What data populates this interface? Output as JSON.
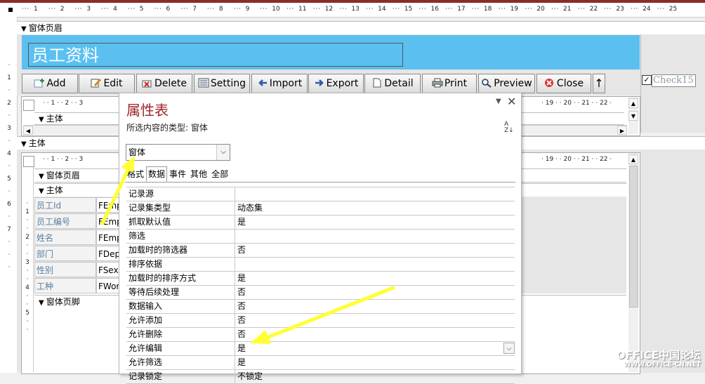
{
  "header": {
    "section_label": "窗体页眉",
    "form_title": "员工资料",
    "checkbox_label": "Check15"
  },
  "ruler_numbers": [
    "1",
    "2",
    "3",
    "4",
    "5",
    "6",
    "7",
    "8",
    "9",
    "10",
    "11",
    "12",
    "13",
    "14",
    "15",
    "16",
    "17",
    "18",
    "19",
    "20",
    "21",
    "22",
    "23",
    "24",
    "25"
  ],
  "toolbar": [
    {
      "label": "Add",
      "icon": "add-icon"
    },
    {
      "label": "Edit",
      "icon": "edit-icon"
    },
    {
      "label": "Delete",
      "icon": "delete-icon"
    },
    {
      "label": "Setting",
      "icon": "setting-icon"
    },
    {
      "label": "Import",
      "icon": "import-icon"
    },
    {
      "label": "Export",
      "icon": "export-icon"
    },
    {
      "label": "Detail",
      "icon": "detail-icon"
    },
    {
      "label": "Print",
      "icon": "print-icon"
    },
    {
      "label": "Preview",
      "icon": "preview-icon"
    },
    {
      "label": "Close",
      "icon": "close-icon"
    }
  ],
  "up_arrow": "↑",
  "subform_top": {
    "section_label": "主体",
    "ruler_text": "· · 1 · · 2 · · 3",
    "ruler_right": "· 19 · · 20 · · 21 · · 22 ·"
  },
  "main_section_label": "主体",
  "subform": {
    "ruler_text": "· · 1 · · 2 · · 3",
    "ruler_right": "· 19 · · 20 · · 21 · · 22 ·",
    "header_label": "窗体页眉",
    "body_label": "主体",
    "footer_label": "窗体页脚",
    "fields": [
      {
        "label": "员工Id",
        "value": "FEmp"
      },
      {
        "label": "员工编号",
        "value": "FEmp"
      },
      {
        "label": "姓名",
        "value": "FEmp"
      },
      {
        "label": "部门",
        "value": "FDep"
      },
      {
        "label": "性别",
        "value": "FSex"
      },
      {
        "label": "工种",
        "value": "FWor"
      }
    ],
    "vruler_numbers": [
      "1",
      "2",
      "3",
      "4",
      "5",
      "6",
      "7"
    ]
  },
  "property_sheet": {
    "title": "属性表",
    "subtitle": "所选内容的类型:  窗体",
    "sort_icon": "A↓Z",
    "selector_value": "窗体",
    "tabs": [
      "格式",
      "数据",
      "事件",
      "其他",
      "全部"
    ],
    "active_tab": "数据",
    "rows": [
      {
        "key": "记录源",
        "value": ""
      },
      {
        "key": "记录集类型",
        "value": "动态集"
      },
      {
        "key": "抓取默认值",
        "value": "是"
      },
      {
        "key": "筛选",
        "value": ""
      },
      {
        "key": "加载时的筛选器",
        "value": "否"
      },
      {
        "key": "排序依据",
        "value": ""
      },
      {
        "key": "加载时的排序方式",
        "value": "是"
      },
      {
        "key": "等待后续处理",
        "value": "否"
      },
      {
        "key": "数据输入",
        "value": "否"
      },
      {
        "key": "允许添加",
        "value": "否"
      },
      {
        "key": "允许删除",
        "value": "否"
      },
      {
        "key": "允许编辑",
        "value": "是"
      },
      {
        "key": "允许筛选",
        "value": "是"
      },
      {
        "key": "记录锁定",
        "value": "不锁定"
      }
    ]
  },
  "watermark": {
    "line1": "OFFICE中国论坛",
    "line2": "WWW.OFFICE-CN.NET"
  },
  "colors": {
    "header_blue": "#5bc0f0",
    "title_red": "#a0262a",
    "arrow_yellow": "#ffff33"
  }
}
